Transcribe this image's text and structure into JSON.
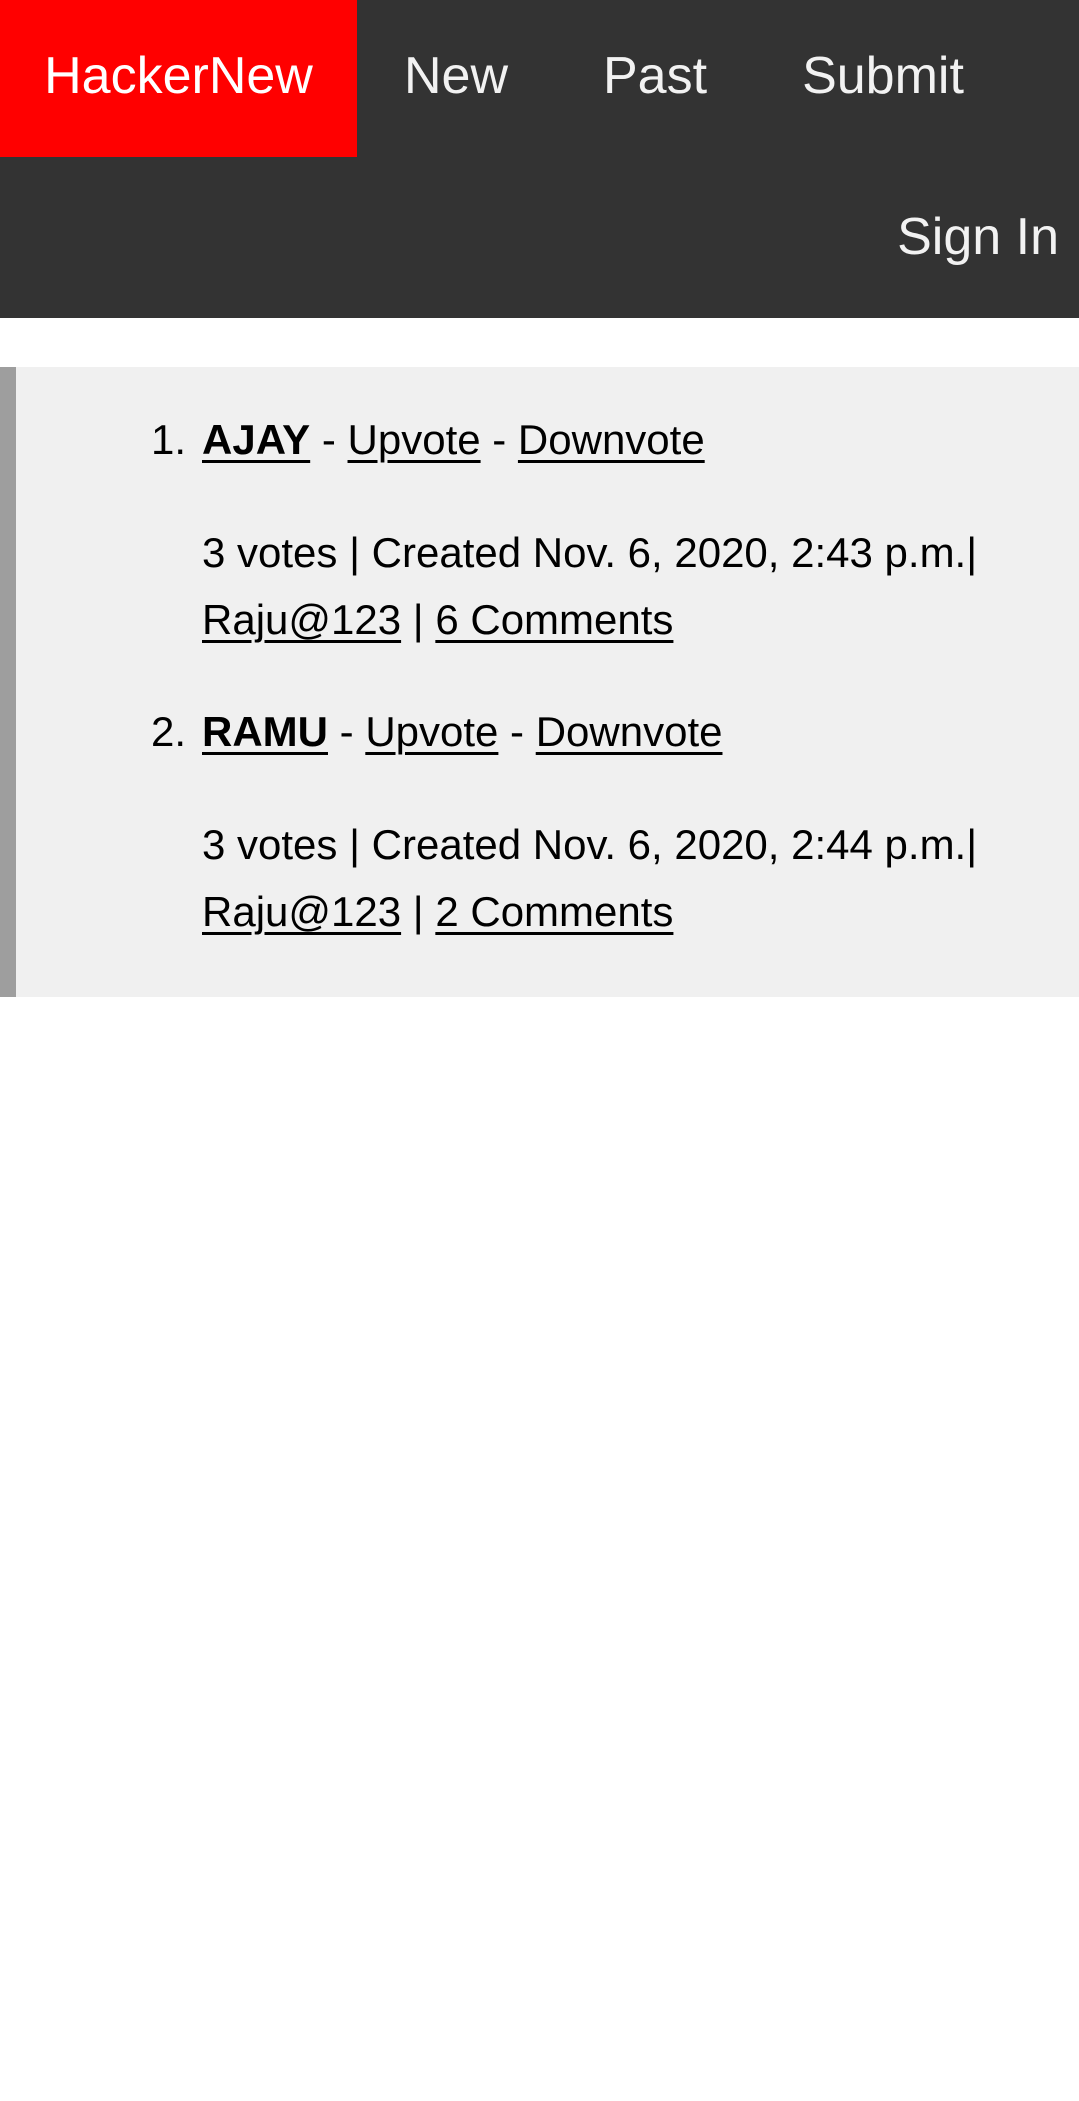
{
  "nav": {
    "brand": "HackerNew",
    "new": "New",
    "past": "Past",
    "submit": "Submit",
    "sign_in": "Sign In"
  },
  "separators": {
    "dash": " - ",
    "pipe": " | ",
    "pipe_tight": "| "
  },
  "stories": [
    {
      "number": "1.",
      "title": "AJAY",
      "upvote": "Upvote",
      "downvote": "Downvote",
      "meta": "3 votes | Created Nov. 6, 2020, 2:43 p.m.|",
      "author": "Raju@123",
      "comments": "6 Comments"
    },
    {
      "number": "2.",
      "title": "RAMU",
      "upvote": "Upvote",
      "downvote": "Downvote",
      "meta": "3 votes | Created Nov. 6, 2020, 2:44 p.m.|",
      "author": "Raju@123",
      "comments": "2 Comments"
    }
  ],
  "colors": {
    "nav_background": "#333333",
    "brand_background": "#ff0000",
    "content_background": "#f0f0f0",
    "content_border": "#9e9e9e"
  }
}
